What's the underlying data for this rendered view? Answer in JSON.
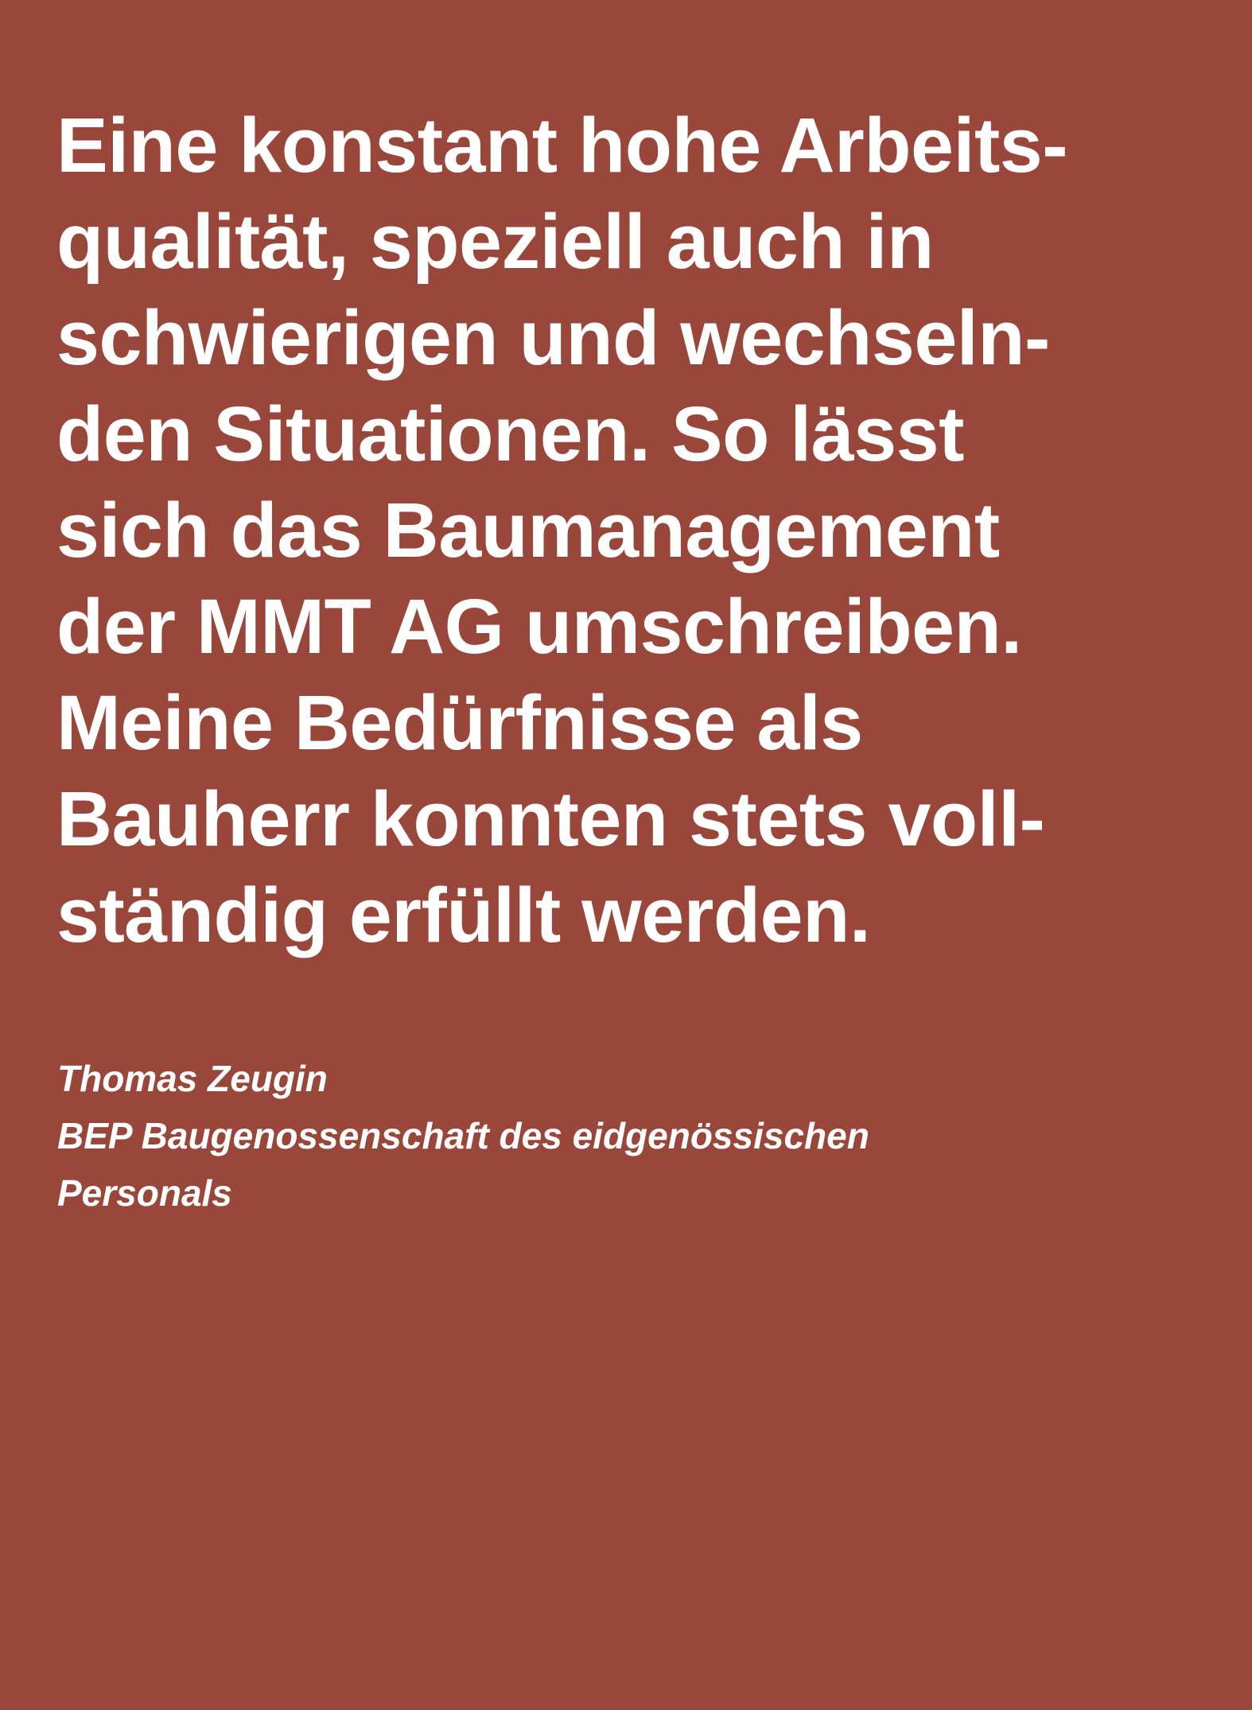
{
  "colors": {
    "background": "#99473b",
    "text": "#ffffff"
  },
  "quote": {
    "lines": [
      "Eine konstant hohe Arbeits-",
      "qualität, speziell auch in",
      "schwierigen und wechseln-",
      "den Situationen. So lässt",
      "sich das Baumanagement",
      "der MMT AG umschreiben.",
      "Meine Bedürfnisse als",
      "Bauherr konnten stets voll-",
      "ständig erfüllt werden."
    ]
  },
  "attribution": {
    "name": "Thomas Zeugin",
    "organization_line1": "BEP Baugenossenschaft des eidgenössischen",
    "organization_line2": "Personals"
  }
}
